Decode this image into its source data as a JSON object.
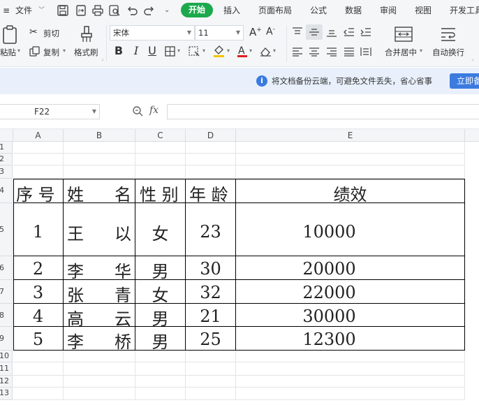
{
  "menu": {
    "file": "文件",
    "tabs": [
      "开始",
      "插入",
      "页面布局",
      "公式",
      "数据",
      "审阅",
      "视图",
      "开发工具"
    ]
  },
  "ribbon": {
    "cut": "剪切",
    "paste": "粘贴",
    "copy": "复制",
    "format_painter": "格式刷",
    "font_name": "宋体",
    "font_size": "11",
    "merge_center": "合并居中",
    "wrap_text": "自动换行"
  },
  "notice": {
    "text": "将文档备份云端，可避免文件丢失，省心省事",
    "button": "立即备份"
  },
  "formula_bar": {
    "name_box": "F22",
    "fx": "fx",
    "formula": ""
  },
  "columns": [
    "A",
    "B",
    "C",
    "D",
    "E"
  ],
  "rows": [
    "1",
    "2",
    "3",
    "4",
    "5",
    "6",
    "7",
    "8",
    "9",
    "10",
    "11",
    "12",
    "13"
  ],
  "table": {
    "headers": [
      "序 号",
      "姓名",
      "性 别",
      "年 龄",
      "绩效"
    ],
    "header_name_chars": [
      "姓",
      "名"
    ],
    "records": [
      {
        "no": "1",
        "name": [
          "王",
          "以"
        ],
        "gender": "女",
        "age": "23",
        "score": "10000"
      },
      {
        "no": "2",
        "name": [
          "李",
          "华"
        ],
        "gender": "男",
        "age": "30",
        "score": "20000"
      },
      {
        "no": "3",
        "name": [
          "张",
          "青"
        ],
        "gender": "女",
        "age": "32",
        "score": "22000"
      },
      {
        "no": "4",
        "name": [
          "高",
          "云"
        ],
        "gender": "男",
        "age": "21",
        "score": "30000"
      },
      {
        "no": "5",
        "name": [
          "李",
          "桥"
        ],
        "gender": "男",
        "age": "25",
        "score": "12300"
      }
    ]
  },
  "colors": {
    "accent_green": "#1ba94c",
    "accent_blue": "#3b7be0",
    "notice_bg": "#e9f0fb",
    "ribbon_bg": "#f4f6f8"
  }
}
